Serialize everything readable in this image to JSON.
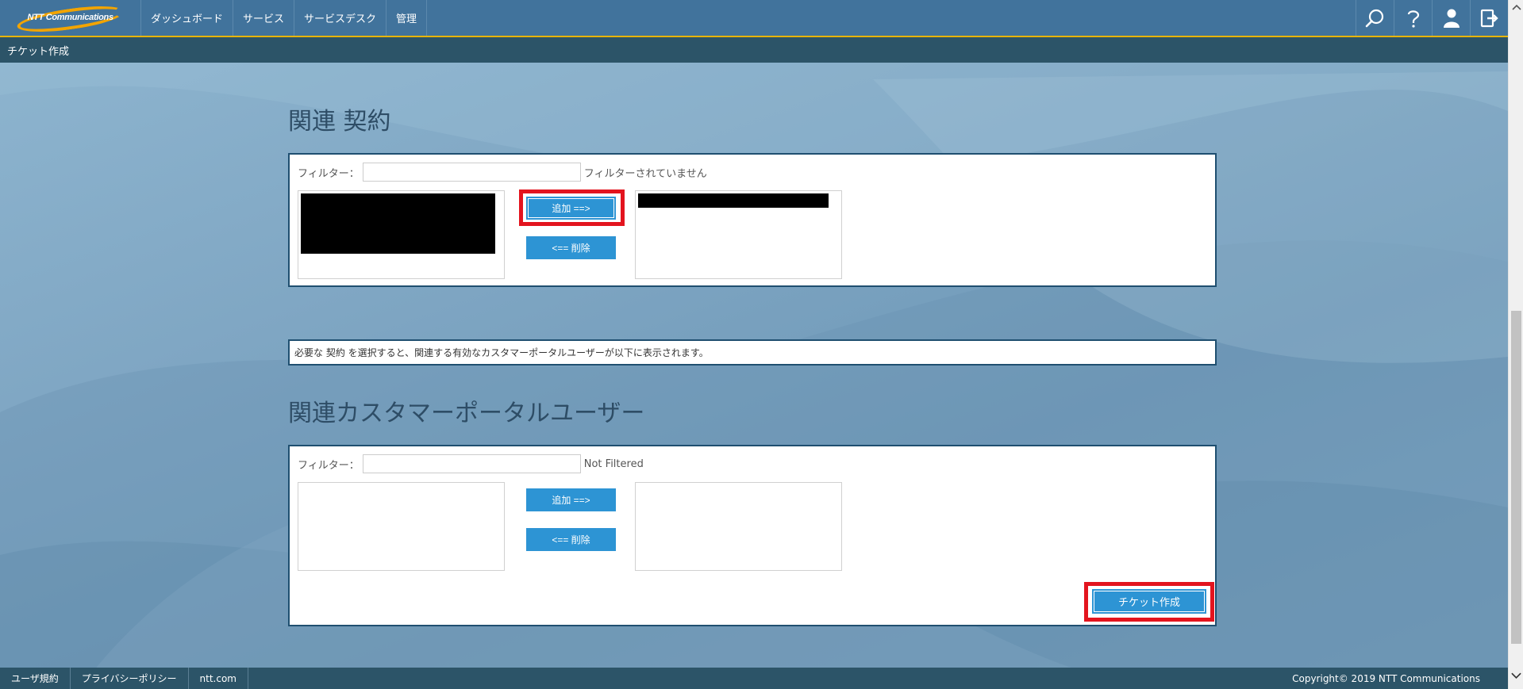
{
  "header": {
    "logo_text": "NTT Communications",
    "nav": [
      {
        "label": "ダッシュボード"
      },
      {
        "label": "サービス"
      },
      {
        "label": "サービスデスク"
      },
      {
        "label": "管理"
      }
    ],
    "icons": [
      "search-icon",
      "help-icon",
      "user-icon",
      "logout-icon"
    ]
  },
  "subbar": {
    "title": "チケット作成"
  },
  "contracts": {
    "title": "関連 契約",
    "filter_label": "フィルター：",
    "filter_value": "",
    "filter_status": "フィルターされていません",
    "add_label": "追加 ==>",
    "remove_label": "<== 削除"
  },
  "info": {
    "text": "必要な 契約 を選択すると、関連する有効なカスタマーポータルユーザーが以下に表示されます。"
  },
  "users": {
    "title": "関連カスタマーポータルユーザー",
    "filter_label": "フィルター：",
    "filter_value": "",
    "filter_status": "Not Filtered",
    "add_label": "追加 ==>",
    "remove_label": "<== 削除"
  },
  "actions": {
    "create_ticket_label": "チケット作成"
  },
  "footer": {
    "links": [
      {
        "label": "ユーザ規約"
      },
      {
        "label": "プライバシーポリシー"
      },
      {
        "label": "ntt.com"
      }
    ],
    "copyright": "Copyright© 2019 NTT Communications"
  },
  "colors": {
    "topbar": "#41739c",
    "subbar": "#2c5468",
    "accent_line": "#e8b400",
    "button": "#2d94d4",
    "highlight": "#e3141e"
  }
}
